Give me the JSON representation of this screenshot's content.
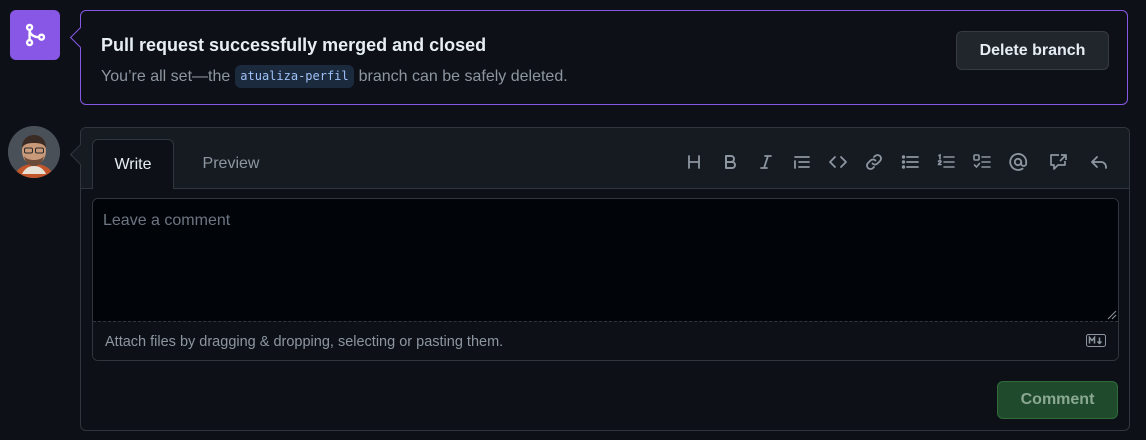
{
  "merge": {
    "title": "Pull request successfully merged and closed",
    "desc_prefix": "You’re all set—the",
    "branch": "atualiza-perfil",
    "desc_suffix": "branch can be safely deleted.",
    "delete_button": "Delete branch",
    "icon": "git-merge-icon",
    "accent": "#8957e5"
  },
  "comment": {
    "tabs": {
      "write": "Write",
      "preview": "Preview"
    },
    "toolbar_icons": [
      "heading-icon",
      "bold-icon",
      "italic-icon",
      "quote-icon",
      "code-icon",
      "link-icon",
      "bulleted-list-icon",
      "numbered-list-icon",
      "task-list-icon",
      "mention-icon",
      "cross-reference-icon",
      "saved-replies-icon"
    ],
    "placeholder": "Leave a comment",
    "value": "",
    "attach_text": "Attach files by dragging & dropping, selecting or pasting them.",
    "submit_button": "Comment",
    "submit_color": "#238636"
  }
}
